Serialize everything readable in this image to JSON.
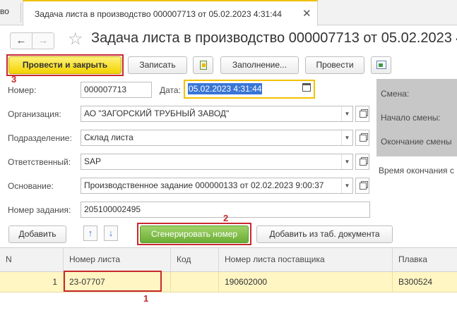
{
  "tabs": {
    "previous_tab": "во",
    "active_tab": "Задача листа в производство 000007713 от 05.02.2023 4:31:44",
    "close_icon": "close-icon"
  },
  "nav": {
    "back_icon": "arrow-left-icon",
    "forward_icon": "arrow-right-icon",
    "favorite_icon": "star-icon"
  },
  "title": "Задача листа в производство 000007713 от 05.02.2023 4:3",
  "toolbar": {
    "post_close": "Провести и закрыть",
    "save": "Записать",
    "fill": "Заполнение...",
    "post": "Провести"
  },
  "form": {
    "number_label": "Номер:",
    "number_value": "000007713",
    "date_label": "Дата:",
    "date_value": "05.02.2023  4:31:44",
    "org_label": "Организация:",
    "org_value": "АО \"ЗАГОРСКИЙ ТРУБНЫЙ ЗАВОД\"",
    "dept_label": "Подразделение:",
    "dept_value": "Склад листа",
    "resp_label": "Ответственный:",
    "resp_value": "SAP",
    "basis_label": "Основание:",
    "basis_value": "Производственное задание 000000133 от 02.02.2023 9:00:37",
    "task_label": "Номер задания:",
    "task_value": "205100002495"
  },
  "side": {
    "shift": "Смена:",
    "shift_start": "Начало смены:",
    "shift_end": "Окончание смены",
    "end_time": "Время окончания с"
  },
  "table_toolbar": {
    "add": "Добавить",
    "generate": "Сгенерировать номер",
    "add_from_doc": "Добавить из таб. документа"
  },
  "table": {
    "columns": [
      "N",
      "Номер листа",
      "Код",
      "Номер листа поставщика",
      "Плавка"
    ],
    "rows": [
      [
        "1",
        "23-07707",
        "",
        "190602000",
        "B300524"
      ]
    ]
  },
  "callouts": {
    "one": "1",
    "two": "2",
    "three": "3"
  },
  "colors": {
    "accent_yellow": "#f3d300",
    "highlight_red": "#c8292f",
    "generate_green": "#6cad34",
    "selected_row": "#fff6c3"
  }
}
